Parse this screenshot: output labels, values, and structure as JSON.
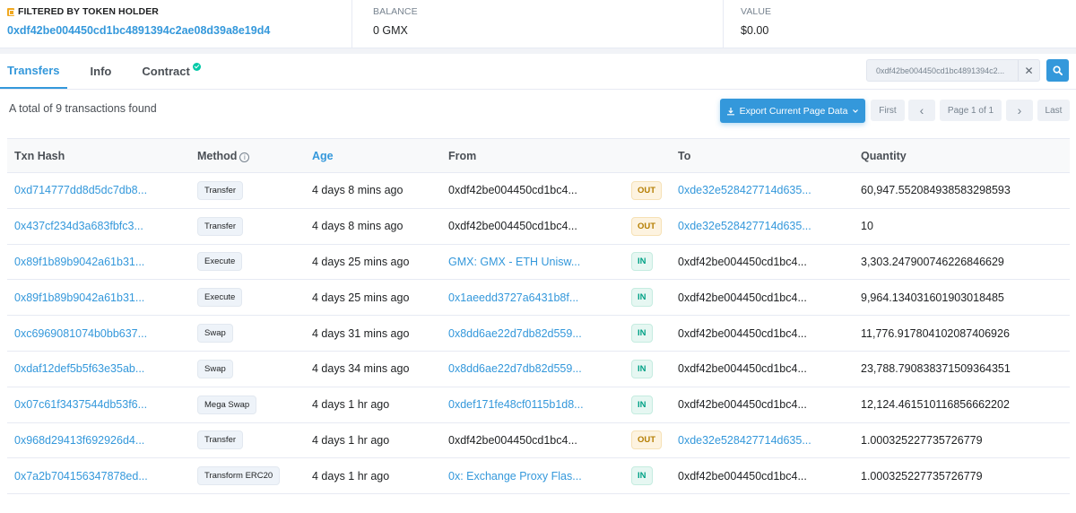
{
  "summary": {
    "filter_label": "FILTERED BY TOKEN HOLDER",
    "holder_address": "0xdf42be004450cd1bc4891394c2ae08d39a8e19d4",
    "balance_label": "BALANCE",
    "balance_value": "0 GMX",
    "value_label": "VALUE",
    "value_amount": "$0.00"
  },
  "tabs": [
    {
      "label": "Transfers",
      "active": true
    },
    {
      "label": "Info",
      "active": false
    },
    {
      "label": "Contract",
      "active": false,
      "verified": true
    }
  ],
  "search": {
    "value": "0xdf42be004450cd1bc4891394c2...",
    "clear_glyph": "✕"
  },
  "toolbar": {
    "total_text": "A total of 9 transactions found",
    "export_label": "Export Current Page Data",
    "pager": {
      "first": "First",
      "prev": "‹",
      "page": "Page 1 of 1",
      "next": "›",
      "last": "Last"
    }
  },
  "table": {
    "headers": {
      "hash": "Txn Hash",
      "method": "Method",
      "age": "Age",
      "from": "From",
      "to": "To",
      "quantity": "Quantity"
    },
    "rows": [
      {
        "hash": "0xd714777dd8d5dc7db8...",
        "method": "Transfer",
        "age": "4 days 8 mins ago",
        "from": "0xdf42be004450cd1bc4...",
        "from_link": false,
        "dir": "OUT",
        "to": "0xde32e528427714d635...",
        "to_link": true,
        "qty": "60,947.552084938583298593"
      },
      {
        "hash": "0x437cf234d3a683fbfc3...",
        "method": "Transfer",
        "age": "4 days 8 mins ago",
        "from": "0xdf42be004450cd1bc4...",
        "from_link": false,
        "dir": "OUT",
        "to": "0xde32e528427714d635...",
        "to_link": true,
        "qty": "10"
      },
      {
        "hash": "0x89f1b89b9042a61b31...",
        "method": "Execute",
        "age": "4 days 25 mins ago",
        "from": "GMX: GMX - ETH Unisw...",
        "from_link": true,
        "dir": "IN",
        "to": "0xdf42be004450cd1bc4...",
        "to_link": false,
        "qty": "3,303.247900746226846629"
      },
      {
        "hash": "0x89f1b89b9042a61b31...",
        "method": "Execute",
        "age": "4 days 25 mins ago",
        "from": "0x1aeedd3727a6431b8f...",
        "from_link": true,
        "dir": "IN",
        "to": "0xdf42be004450cd1bc4...",
        "to_link": false,
        "qty": "9,964.134031601903018485"
      },
      {
        "hash": "0xc6969081074b0bb637...",
        "method": "Swap",
        "age": "4 days 31 mins ago",
        "from": "0x8dd6ae22d7db82d559...",
        "from_link": true,
        "dir": "IN",
        "to": "0xdf42be004450cd1bc4...",
        "to_link": false,
        "qty": "11,776.917804102087406926"
      },
      {
        "hash": "0xdaf12def5b5f63e35ab...",
        "method": "Swap",
        "age": "4 days 34 mins ago",
        "from": "0x8dd6ae22d7db82d559...",
        "from_link": true,
        "dir": "IN",
        "to": "0xdf42be004450cd1bc4...",
        "to_link": false,
        "qty": "23,788.790838371509364351"
      },
      {
        "hash": "0x07c61f3437544db53f6...",
        "method": "Mega Swap",
        "age": "4 days 1 hr ago",
        "from": "0xdef171fe48cf0115b1d8...",
        "from_link": true,
        "dir": "IN",
        "to": "0xdf42be004450cd1bc4...",
        "to_link": false,
        "qty": "12,124.461510116856662202"
      },
      {
        "hash": "0x968d29413f692926d4...",
        "method": "Transfer",
        "age": "4 days 1 hr ago",
        "from": "0xdf42be004450cd1bc4...",
        "from_link": false,
        "dir": "OUT",
        "to": "0xde32e528427714d635...",
        "to_link": true,
        "qty": "1.000325227735726779"
      },
      {
        "hash": "0x7a2b704156347878ed...",
        "method": "Transform ERC20",
        "age": "4 days 1 hr ago",
        "from": "0x: Exchange Proxy Flas...",
        "from_link": true,
        "dir": "IN",
        "to": "0xdf42be004450cd1bc4...",
        "to_link": false,
        "qty": "1.000325227735726779"
      }
    ]
  },
  "colors": {
    "accent": "#3498db",
    "in_green": "#00a186",
    "out_amber": "#b47d00",
    "verified": "#00c9a7",
    "filter_icon": "#f0a820"
  }
}
